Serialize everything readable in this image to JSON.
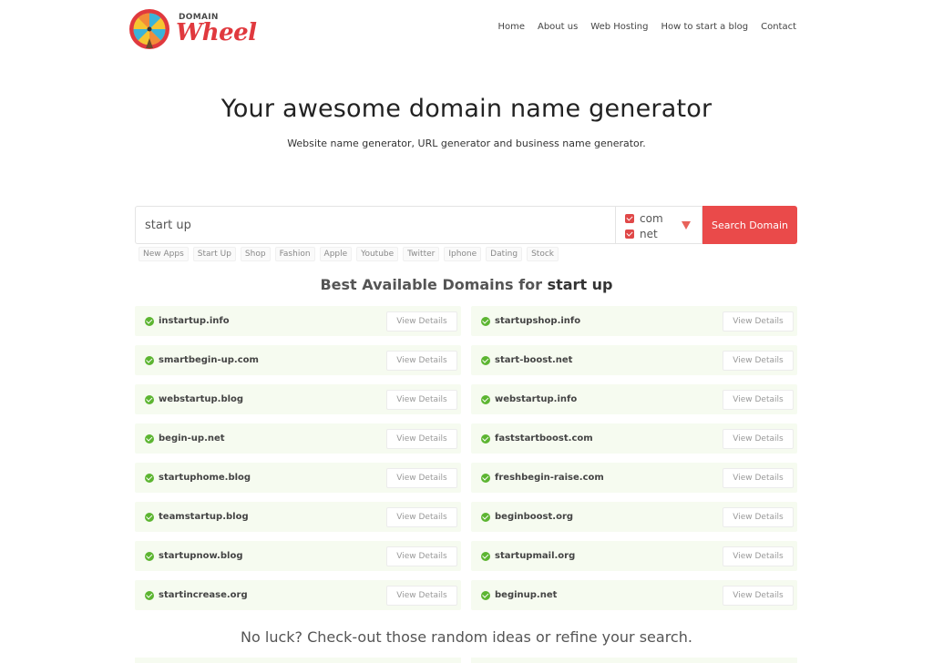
{
  "brand": {
    "top_word": "DOMAIN",
    "main_word": "Wheel",
    "accent_color": "#e0393e"
  },
  "nav": {
    "items": [
      {
        "label": "Home"
      },
      {
        "label": "About us"
      },
      {
        "label": "Web Hosting"
      },
      {
        "label": "How to start a blog"
      },
      {
        "label": "Contact"
      }
    ]
  },
  "hero": {
    "title": "Your awesome domain name generator",
    "subtitle": "Website name generator, URL generator and business name generator."
  },
  "search": {
    "value": "start up",
    "tlds": [
      {
        "label": "com",
        "checked": true
      },
      {
        "label": "net",
        "checked": true
      }
    ],
    "dropdown_icon": "caret-down-icon",
    "button_label": "Search Domain",
    "button_color": "#ea4a4a"
  },
  "tags": [
    "New Apps",
    "Start Up",
    "Shop",
    "Fashion",
    "Apple",
    "Youtube",
    "Twitter",
    "Iphone",
    "Dating",
    "Stock"
  ],
  "results": {
    "heading_prefix": "Best Available Domains for",
    "heading_query": "start up",
    "status_icon": "check-circle-icon",
    "status_color": "#5cb531",
    "button_label": "View Details",
    "domains": [
      "instartup.info",
      "startupshop.info",
      "smartbegin-up.com",
      "start-boost.net",
      "webstartup.blog",
      "webstartup.info",
      "begin-up.net",
      "faststartboost.com",
      "startuphome.blog",
      "freshbegin-raise.com",
      "teamstartup.blog",
      "beginboost.org",
      "startupnow.blog",
      "startupmail.org",
      "startincrease.org",
      "beginup.net"
    ]
  },
  "footer_prompt": "No luck? Check-out those random ideas or refine your search."
}
